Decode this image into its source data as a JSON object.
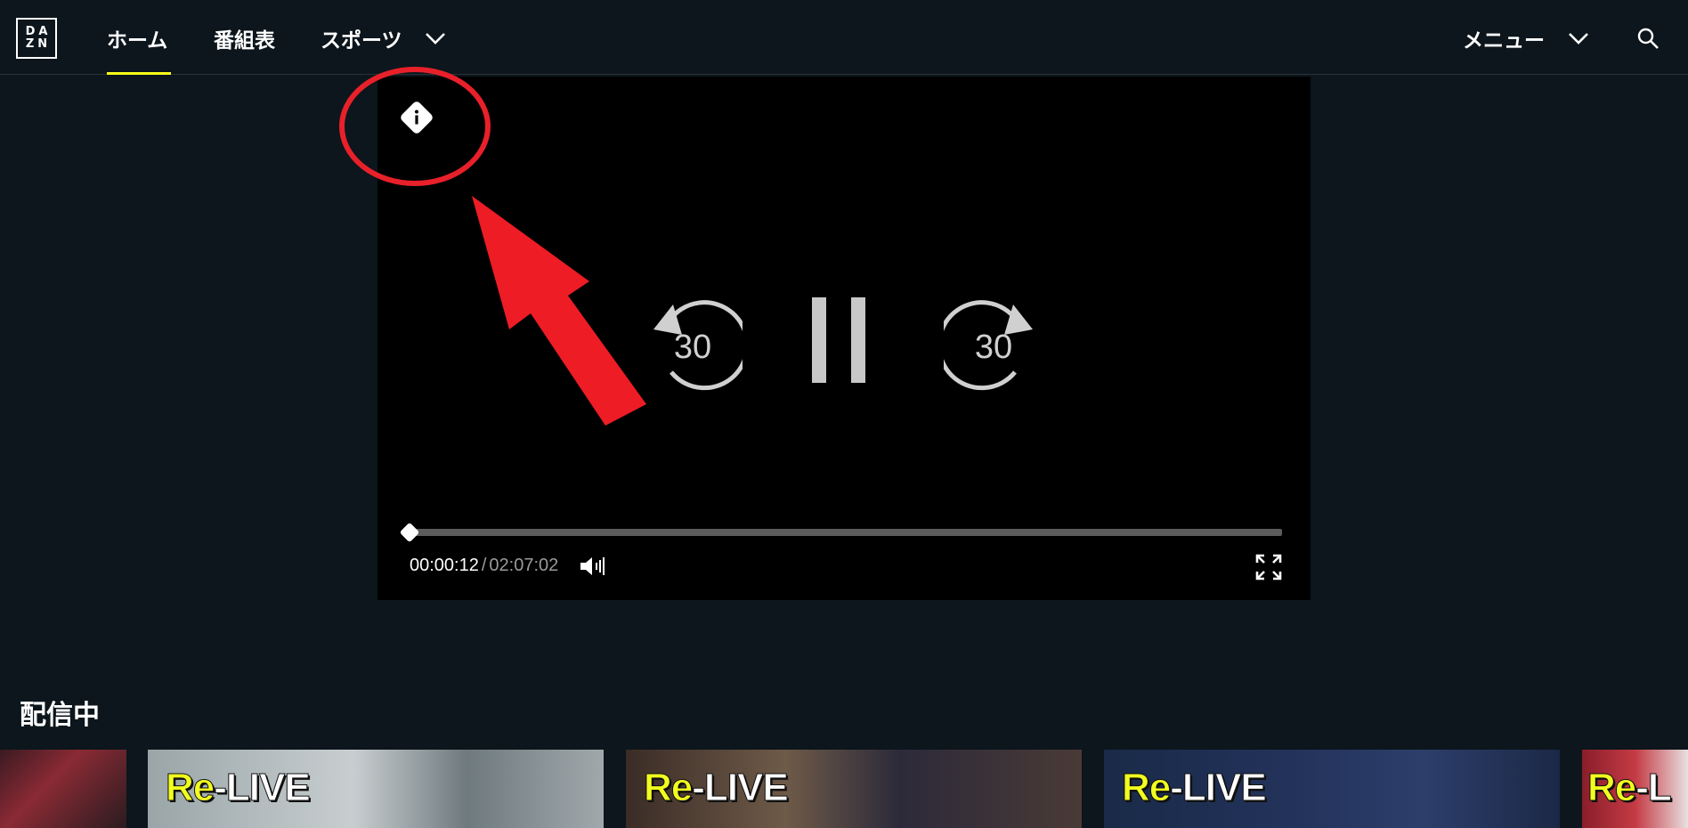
{
  "header": {
    "logo_lines": [
      "DA",
      "ZN"
    ],
    "nav": [
      {
        "label": "ホーム",
        "active": true
      },
      {
        "label": "番組表",
        "active": false
      },
      {
        "label": "スポーツ",
        "active": false
      }
    ],
    "menu_label": "メニュー",
    "accent_color": "#f7ff1a"
  },
  "player": {
    "skip_back_label": "30",
    "skip_forward_label": "30",
    "current_time": "00:00:12",
    "separator": "/",
    "duration": "02:07:02",
    "progress_fraction": 0.0016
  },
  "annotation": {
    "circle_color": "#e8202a",
    "arrow_color": "#ee1c25"
  },
  "section": {
    "title": "配信中",
    "tiles": [
      {
        "badge_re": "",
        "badge_live": ""
      },
      {
        "badge_re": "Re",
        "badge_live": "-LIVE"
      },
      {
        "badge_re": "Re",
        "badge_live": "-LIVE"
      },
      {
        "badge_re": "Re",
        "badge_live": "-LIVE"
      },
      {
        "badge_re": "Re",
        "badge_live": "-L"
      }
    ]
  }
}
